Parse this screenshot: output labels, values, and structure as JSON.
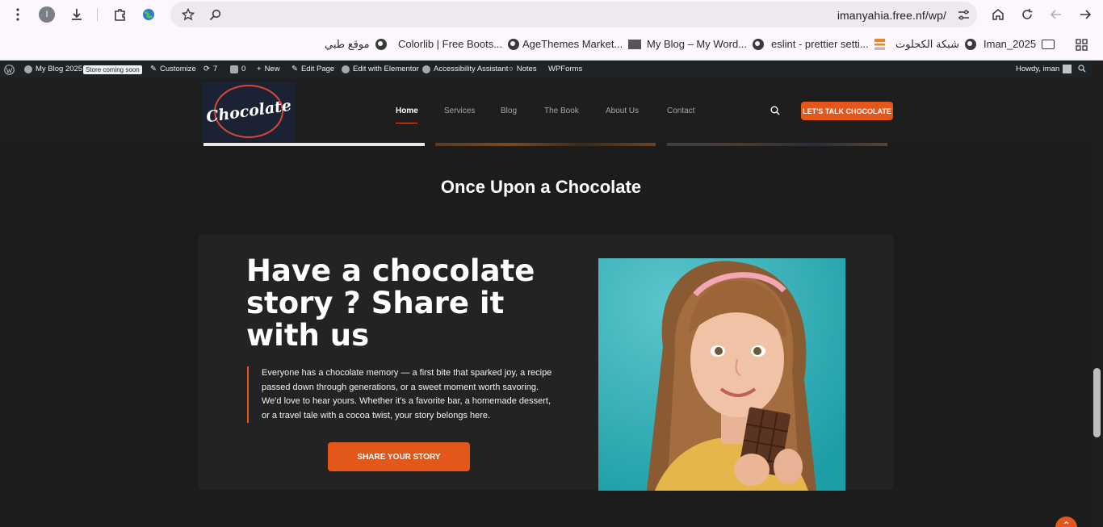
{
  "browser": {
    "profile_initial": "I",
    "url": "imanyahia.free.nf/wp/"
  },
  "bookmarks": [
    {
      "label": "موقع طبي"
    },
    {
      "label": "Colorlib | Free Boots..."
    },
    {
      "label": "AgeThemes Market..."
    },
    {
      "label": "My Blog – My Word..."
    },
    {
      "label": "eslint - prettier setti..."
    },
    {
      "label": "شبكة الكحلوت"
    },
    {
      "label": "Iman_2025"
    }
  ],
  "adminbar": {
    "site_name": "My Blog 2025",
    "store_badge": "Store coming soon",
    "customize": "Customize",
    "updates_count": "7",
    "comments_count": "0",
    "new": "New",
    "edit_page": "Edit Page",
    "edit_elementor": "Edit with Elementor",
    "accessibility": "Accessibility Assistant",
    "notes": "Notes",
    "wpforms": "WPForms",
    "howdy": "Howdy, iman"
  },
  "header": {
    "logo_text": "Chocolate",
    "nav": [
      "Home",
      "Services",
      "Blog",
      "The Book",
      "About Us",
      "Contact"
    ],
    "active_nav": "Home",
    "cta_label": "LET'S TALK CHOCOLATE"
  },
  "main": {
    "section_title": "Once Upon a Chocolate",
    "headline": "Have a chocolate story ? Share it with us",
    "paragraph": "Everyone has a chocolate memory — a first bite that sparked joy, a recipe passed down through generations, or a sweet moment worth savoring. We'd love to hear yours. Whether it's a favorite bar, a homemade dessert, or a travel tale with a cocoa twist, your story belongs here.",
    "share_button": "SHARE YOUR STORY"
  },
  "colors": {
    "accent": "#e4571a",
    "background": "#1c1c1c",
    "card": "#232323",
    "admin_bar": "#1d2327",
    "photo_background": "#35b0b6"
  }
}
